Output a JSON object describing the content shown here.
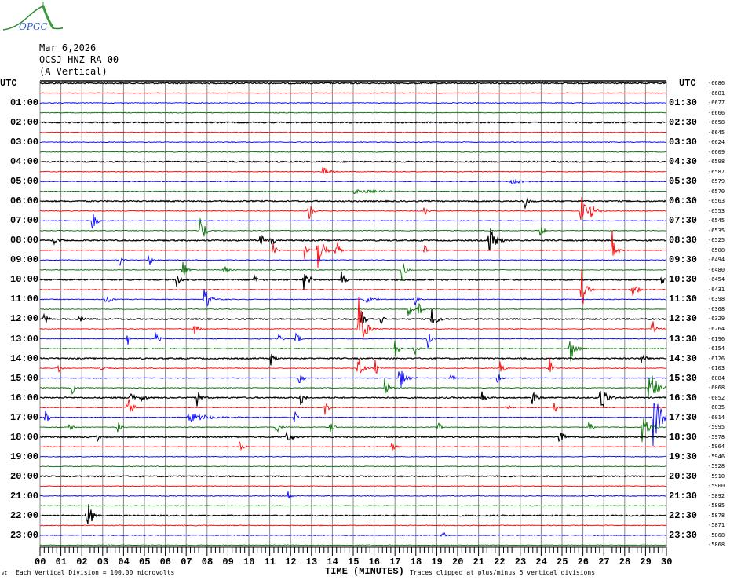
{
  "header": {
    "date": "Mar 6,2026",
    "station": "OCSJ HNZ RA 00",
    "component": "(A Vertical)",
    "logo_text": "OPGC"
  },
  "chart_data": {
    "type": "helicorder",
    "title": "OCSJ HNZ RA 00 (A Vertical)",
    "xlabel": "TIME (MINUTES)",
    "xlim": [
      0,
      30
    ],
    "x_ticks": [
      "00",
      "01",
      "02",
      "03",
      "04",
      "05",
      "06",
      "07",
      "08",
      "09",
      "10",
      "11",
      "12",
      "13",
      "14",
      "15",
      "16",
      "17",
      "18",
      "19",
      "20",
      "21",
      "22",
      "23",
      "24",
      "25",
      "26",
      "27",
      "28",
      "29",
      "30"
    ],
    "rows": 48,
    "row_minutes": 30,
    "trace_colors": [
      "#000000",
      "#ff0000",
      "#0000ff",
      "#007000"
    ],
    "left_labels": [
      "UTC",
      "01:00",
      "02:00",
      "03:00",
      "04:00",
      "05:00",
      "06:00",
      "07:00",
      "08:00",
      "09:00",
      "10:00",
      "11:00",
      "12:00",
      "13:00",
      "14:00",
      "15:00",
      "16:00",
      "17:00",
      "18:00",
      "19:00",
      "20:00",
      "21:00",
      "22:00",
      "23:00"
    ],
    "right_labels": [
      "UTC",
      "01:30",
      "02:30",
      "03:30",
      "04:30",
      "05:30",
      "06:30",
      "07:30",
      "08:30",
      "09:30",
      "10:30",
      "11:30",
      "12:30",
      "13:30",
      "14:30",
      "15:30",
      "16:30",
      "17:30",
      "18:30",
      "19:30",
      "20:30",
      "21:30",
      "22:30",
      "23:30"
    ],
    "row_offsets": [
      "-6686",
      "-6681",
      "-6677",
      "-6666",
      "-6658",
      "-6645",
      "-6624",
      "-6609",
      "-6598",
      "-6587",
      "-6579",
      "-6570",
      "-6563",
      "-6553",
      "-6545",
      "-6535",
      "-6525",
      "-6508",
      "-6494",
      "-6480",
      "-6454",
      "-6431",
      "-6398",
      "-6368",
      "-6329",
      "-6264",
      "-6196",
      "-6154",
      "-6126",
      "-6103",
      "-6084",
      "-6068",
      "-6052",
      "-6035",
      "-6014",
      "-5995",
      "-5978",
      "-5964",
      "-5946",
      "-5928",
      "-5910",
      "-5900",
      "-5892",
      "-5885",
      "-5878",
      "-5871",
      "-5868",
      "-5868"
    ],
    "scale_note": "Each Vertical Division =  100.00 microvolts",
    "clip_note": "Traces clipped at plus/minus 5 vertical divisions",
    "events_row_minute_amplitude_duration": [
      [
        9,
        13.5,
        0.5,
        0.8
      ],
      [
        10,
        22.5,
        0.4,
        1.2
      ],
      [
        11,
        15.0,
        0.3,
        2.0
      ],
      [
        12,
        23.2,
        1.0,
        0.3
      ],
      [
        13,
        25.9,
        1.8,
        0.6
      ],
      [
        13,
        26.35,
        1.3,
        0.4
      ],
      [
        13,
        12.86,
        1.2,
        0.3
      ],
      [
        13,
        18.4,
        0.6,
        0.3
      ],
      [
        14,
        2.5,
        1.5,
        0.3
      ],
      [
        15,
        7.67,
        1.8,
        0.4
      ],
      [
        15,
        23.95,
        0.9,
        0.3
      ],
      [
        16,
        0.64,
        0.8,
        0.3
      ],
      [
        16,
        10.5,
        1.2,
        0.3
      ],
      [
        16,
        11.05,
        0.8,
        0.3
      ],
      [
        16,
        21.5,
        1.6,
        0.6
      ],
      [
        17,
        13.3,
        3.6,
        0.4
      ],
      [
        17,
        27.4,
        2.2,
        0.3
      ],
      [
        17,
        11.17,
        0.9,
        0.3
      ],
      [
        17,
        12.67,
        1.0,
        0.3
      ],
      [
        17,
        14.17,
        1.5,
        0.3
      ],
      [
        17,
        18.4,
        0.8,
        0.3
      ],
      [
        18,
        3.8,
        0.8,
        0.3
      ],
      [
        18,
        5.2,
        0.8,
        0.3
      ],
      [
        19,
        6.84,
        1.1,
        0.3
      ],
      [
        19,
        8.8,
        0.9,
        0.3
      ],
      [
        19,
        17.33,
        1.3,
        0.3
      ],
      [
        20,
        12.63,
        1.4,
        0.4
      ],
      [
        20,
        14.44,
        1.0,
        0.3
      ],
      [
        20,
        6.54,
        0.9,
        0.3
      ],
      [
        20,
        10.26,
        0.6,
        0.3
      ],
      [
        20,
        29.77,
        1.0,
        0.3
      ],
      [
        21,
        25.9,
        2.6,
        0.4
      ],
      [
        21,
        28.35,
        1.2,
        0.4
      ],
      [
        22,
        3.16,
        1.0,
        0.3
      ],
      [
        22,
        7.86,
        1.3,
        0.5
      ],
      [
        22,
        15.5,
        0.5,
        0.8
      ],
      [
        22,
        17.93,
        0.8,
        0.3
      ],
      [
        23,
        17.63,
        1.1,
        0.3
      ],
      [
        23,
        18.12,
        1.1,
        0.3
      ],
      [
        24,
        0.15,
        0.6,
        0.4
      ],
      [
        24,
        1.84,
        0.6,
        0.3
      ],
      [
        24,
        15.38,
        1.2,
        0.3
      ],
      [
        24,
        16.3,
        0.7,
        0.3
      ],
      [
        24,
        18.76,
        1.6,
        0.4
      ],
      [
        25,
        7.4,
        1.0,
        0.3
      ],
      [
        25,
        15.26,
        3.5,
        0.5
      ],
      [
        25,
        29.3,
        1.5,
        0.3
      ],
      [
        26,
        4.17,
        0.9,
        0.3
      ],
      [
        26,
        5.53,
        0.8,
        0.3
      ],
      [
        26,
        11.43,
        0.5,
        0.3
      ],
      [
        26,
        12.26,
        0.9,
        0.3
      ],
      [
        26,
        18.57,
        1.0,
        0.3
      ],
      [
        27,
        17.0,
        1.2,
        0.3
      ],
      [
        27,
        17.9,
        1.0,
        0.3
      ],
      [
        27,
        25.38,
        1.6,
        0.5
      ],
      [
        28,
        11.05,
        0.8,
        0.3
      ],
      [
        28,
        28.8,
        0.8,
        0.3
      ],
      [
        29,
        0.8,
        0.9,
        0.3
      ],
      [
        29,
        2.9,
        0.9,
        0.3
      ],
      [
        29,
        15.2,
        1.6,
        0.4
      ],
      [
        29,
        16.05,
        0.9,
        0.3
      ],
      [
        29,
        22.03,
        1.1,
        0.3
      ],
      [
        29,
        24.4,
        1.3,
        0.3
      ],
      [
        30,
        12.37,
        1.0,
        0.3
      ],
      [
        30,
        17.2,
        1.5,
        0.5
      ],
      [
        30,
        19.6,
        1.0,
        0.3
      ],
      [
        30,
        21.9,
        1.0,
        0.3
      ],
      [
        31,
        1.54,
        0.7,
        0.3
      ],
      [
        31,
        16.5,
        1.5,
        0.4
      ],
      [
        31,
        29.14,
        2.5,
        0.6
      ],
      [
        32,
        4.29,
        1.1,
        0.3
      ],
      [
        32,
        4.85,
        0.8,
        0.3
      ],
      [
        32,
        7.48,
        1.6,
        0.3
      ],
      [
        32,
        12.48,
        1.2,
        0.3
      ],
      [
        32,
        21.17,
        0.8,
        0.3
      ],
      [
        32,
        23.57,
        1.1,
        0.3
      ],
      [
        32,
        26.84,
        2.8,
        0.4
      ],
      [
        33,
        4.17,
        1.8,
        0.4
      ],
      [
        33,
        13.6,
        1.0,
        0.3
      ],
      [
        33,
        22.33,
        0.5,
        0.3
      ],
      [
        33,
        24.6,
        0.7,
        0.3
      ],
      [
        34,
        0.26,
        0.8,
        0.3
      ],
      [
        34,
        7.1,
        0.5,
        2.2
      ],
      [
        34,
        12.18,
        0.8,
        0.3
      ],
      [
        34,
        29.36,
        3.0,
        0.7
      ],
      [
        35,
        1.4,
        0.5,
        0.3
      ],
      [
        35,
        3.72,
        0.7,
        0.3
      ],
      [
        35,
        11.3,
        0.9,
        0.3
      ],
      [
        35,
        13.87,
        0.8,
        0.3
      ],
      [
        35,
        19.06,
        0.6,
        0.3
      ],
      [
        35,
        26.28,
        0.9,
        0.3
      ],
      [
        35,
        28.83,
        1.8,
        0.5
      ],
      [
        36,
        2.74,
        0.5,
        0.3
      ],
      [
        36,
        11.8,
        1.1,
        0.4
      ],
      [
        36,
        24.85,
        0.9,
        0.4
      ],
      [
        37,
        9.55,
        0.8,
        0.3
      ],
      [
        37,
        16.8,
        0.7,
        0.3
      ],
      [
        42,
        11.88,
        0.6,
        0.2
      ],
      [
        44,
        2.22,
        2.4,
        0.4
      ],
      [
        46,
        19.25,
        0.9,
        0.2
      ]
    ]
  }
}
